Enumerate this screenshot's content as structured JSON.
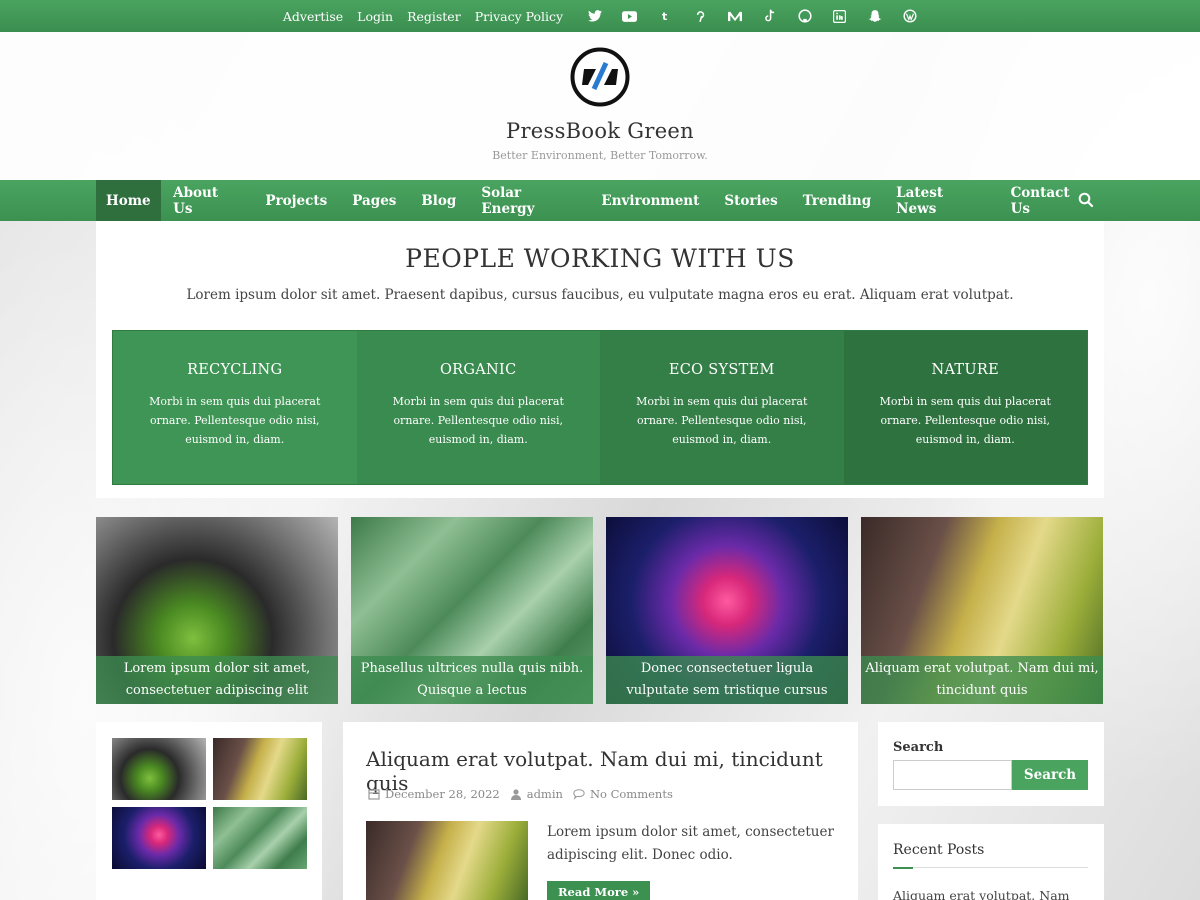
{
  "topbar": {
    "links": [
      "Advertise",
      "Login",
      "Register",
      "Privacy Policy"
    ],
    "social_icons": [
      "twitter-icon",
      "youtube-icon",
      "tumblr-icon",
      "pinterest-icon",
      "medium-icon",
      "tiktok-icon",
      "github-icon",
      "linkedin-icon",
      "snapchat-icon",
      "wordpress-icon"
    ]
  },
  "header": {
    "site_title": "PressBook Green",
    "tagline": "Better Environment, Better Tomorrow."
  },
  "nav": {
    "items": [
      "Home",
      "About Us",
      "Projects",
      "Pages",
      "Blog",
      "Solar Energy",
      "Environment",
      "Stories",
      "Trending",
      "Latest News",
      "Contact Us"
    ],
    "active": "Home"
  },
  "features": {
    "title": "PEOPLE WORKING WITH US",
    "subtitle": "Lorem ipsum dolor sit amet. Praesent dapibus, cursus faucibus, eu vulputate magna eros eu erat. Aliquam erat volutpat.",
    "items": [
      {
        "title": "RECYCLING",
        "text": "Morbi in sem quis dui placerat ornare. Pellentesque odio nisi, euismod in, diam.",
        "color": "#3e9555"
      },
      {
        "title": "ORGANIC",
        "text": "Morbi in sem quis dui placerat ornare. Pellentesque odio nisi, euismod in, diam.",
        "color": "#3a8b4f"
      },
      {
        "title": "ECO SYSTEM",
        "text": "Morbi in sem quis dui placerat ornare. Pellentesque odio nisi, euismod in, diam.",
        "color": "#347f47"
      },
      {
        "title": "NATURE",
        "text": "Morbi in sem quis dui placerat ornare. Pellentesque odio nisi, euismod in, diam.",
        "color": "#2e733f"
      }
    ]
  },
  "tiles": [
    {
      "line1": "Lorem ipsum dolor sit amet,",
      "line2": "consectetuer adipiscing elit"
    },
    {
      "line1": "Phasellus ultrices nulla quis nibh.",
      "line2": "Quisque a lectus"
    },
    {
      "line1": "Donec consectetuer ligula",
      "line2": "vulputate sem tristique cursus"
    },
    {
      "line1": "Aliquam erat volutpat. Nam dui mi,",
      "line2": "tincidunt quis"
    }
  ],
  "post": {
    "title": "Aliquam erat volutpat. Nam dui mi, tincidunt quis",
    "date": "December 28, 2022",
    "author": "admin",
    "comments": "No Comments",
    "excerpt": "Lorem ipsum dolor sit amet, consectetuer adipiscing elit. Donec odio.",
    "read_more": "Read More »"
  },
  "sidebar": {
    "search_label": "Search",
    "search_placeholder": "",
    "search_button": "Search",
    "recent_title": "Recent Posts",
    "recent_first": "Aliquam erat volutpat. Nam"
  },
  "colors": {
    "brand_green": "#4aa460",
    "dark_green": "#2f6f3e"
  }
}
